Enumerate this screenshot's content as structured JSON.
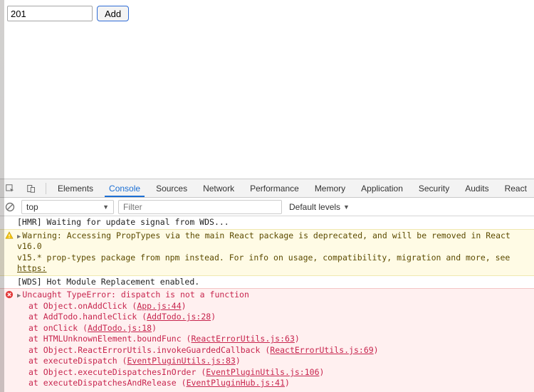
{
  "form": {
    "input_value": "201",
    "add_label": "Add"
  },
  "devtools": {
    "tabs": [
      "Elements",
      "Console",
      "Sources",
      "Network",
      "Performance",
      "Memory",
      "Application",
      "Security",
      "Audits",
      "React"
    ],
    "active_tab": "Console",
    "context": "top",
    "filter_placeholder": "Filter",
    "levels_label": "Default levels"
  },
  "logs": {
    "hmr_wait": "[HMR] Waiting for update signal from WDS...",
    "warn_main": "Warning: Accessing PropTypes via the main React package is deprecated, and will be removed in  React v16.0",
    "warn_sub": "v15.* prop-types package from npm instead. For info on usage, compatibility, migration and more, see ",
    "warn_link": "https:",
    "hmr_enabled": "[WDS] Hot Module Replacement enabled.",
    "err_head": "Uncaught TypeError: dispatch is not a function",
    "stack": [
      {
        "pre": "at Object.onAddClick (",
        "loc": "App.js:44",
        "post": ")"
      },
      {
        "pre": "at AddTodo.handleClick (",
        "loc": "AddTodo.js:28",
        "post": ")"
      },
      {
        "pre": "at onClick (",
        "loc": "AddTodo.js:18",
        "post": ")"
      },
      {
        "pre": "at HTMLUnknownElement.boundFunc (",
        "loc": "ReactErrorUtils.js:63",
        "post": ")"
      },
      {
        "pre": "at Object.ReactErrorUtils.invokeGuardedCallback (",
        "loc": "ReactErrorUtils.js:69",
        "post": ")"
      },
      {
        "pre": "at executeDispatch (",
        "loc": "EventPluginUtils.js:83",
        "post": ")"
      },
      {
        "pre": "at Object.executeDispatchesInOrder (",
        "loc": "EventPluginUtils.js:106",
        "post": ")"
      },
      {
        "pre": "at executeDispatchesAndRelease (",
        "loc": "EventPluginHub.js:41",
        "post": ")"
      }
    ]
  }
}
